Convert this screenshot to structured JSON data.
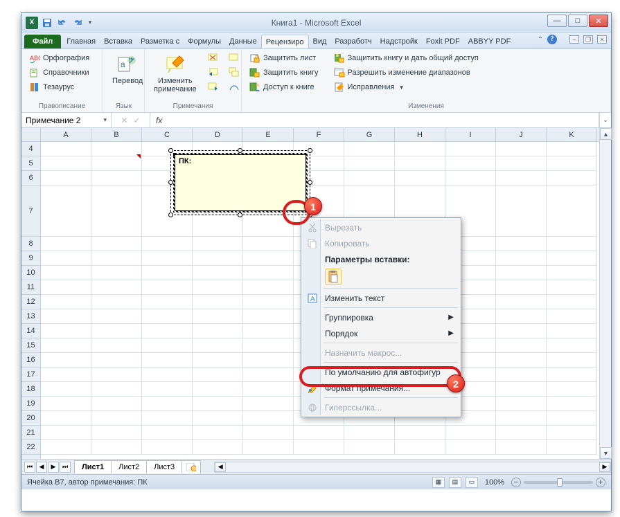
{
  "title": "Книга1 - Microsoft Excel",
  "qat_logo": "X",
  "tabs": {
    "file": "Файл",
    "items": [
      "Главная",
      "Вставка",
      "Разметка с",
      "Формулы",
      "Данные",
      "Рецензиро",
      "Вид",
      "Разработч",
      "Надстройк",
      "Foxit PDF",
      "ABBYY PDF"
    ],
    "active_index": 5
  },
  "ribbon": {
    "grp1": {
      "title": "Правописание",
      "items": [
        "Орфография",
        "Справочники",
        "Тезаурус"
      ]
    },
    "grp2": {
      "title": "Язык",
      "btn": "Перевод"
    },
    "grp3": {
      "title": "Примечания",
      "btn": "Изменить\nпримечание"
    },
    "grp4": {
      "title": "Изменения",
      "col1": [
        "Защитить лист",
        "Защитить книгу",
        "Доступ к книге"
      ],
      "col2": [
        "Защитить книгу и дать общий доступ",
        "Разрешить изменение диапазонов",
        "Исправления"
      ]
    }
  },
  "name_box": "Примечание 2",
  "fx_label": "fx",
  "columns": [
    "A",
    "B",
    "C",
    "D",
    "E",
    "F",
    "G",
    "H",
    "I",
    "J",
    "K"
  ],
  "rows_shown": [
    4,
    5,
    6,
    7,
    8,
    9,
    10,
    11,
    12,
    13,
    14,
    15,
    16,
    17,
    18,
    19,
    20,
    21,
    22
  ],
  "comment_author": "ПК:",
  "context_menu": {
    "cut": "Вырезать",
    "copy": "Копировать",
    "paste_hdr": "Параметры вставки:",
    "edit_text": "Изменить текст",
    "group": "Группировка",
    "order": "Порядок",
    "assign_macro": "Назначить макрос...",
    "default_autoshape": "По умолчанию для автофигур",
    "format_comment": "Формат примечания...",
    "hyperlink": "Гиперссылка..."
  },
  "annotations": {
    "num1": "1",
    "num2": "2"
  },
  "sheets": [
    "Лист1",
    "Лист2",
    "Лист3"
  ],
  "status_left": "Ячейка B7, автор примечания: ПК",
  "zoom": "100%"
}
